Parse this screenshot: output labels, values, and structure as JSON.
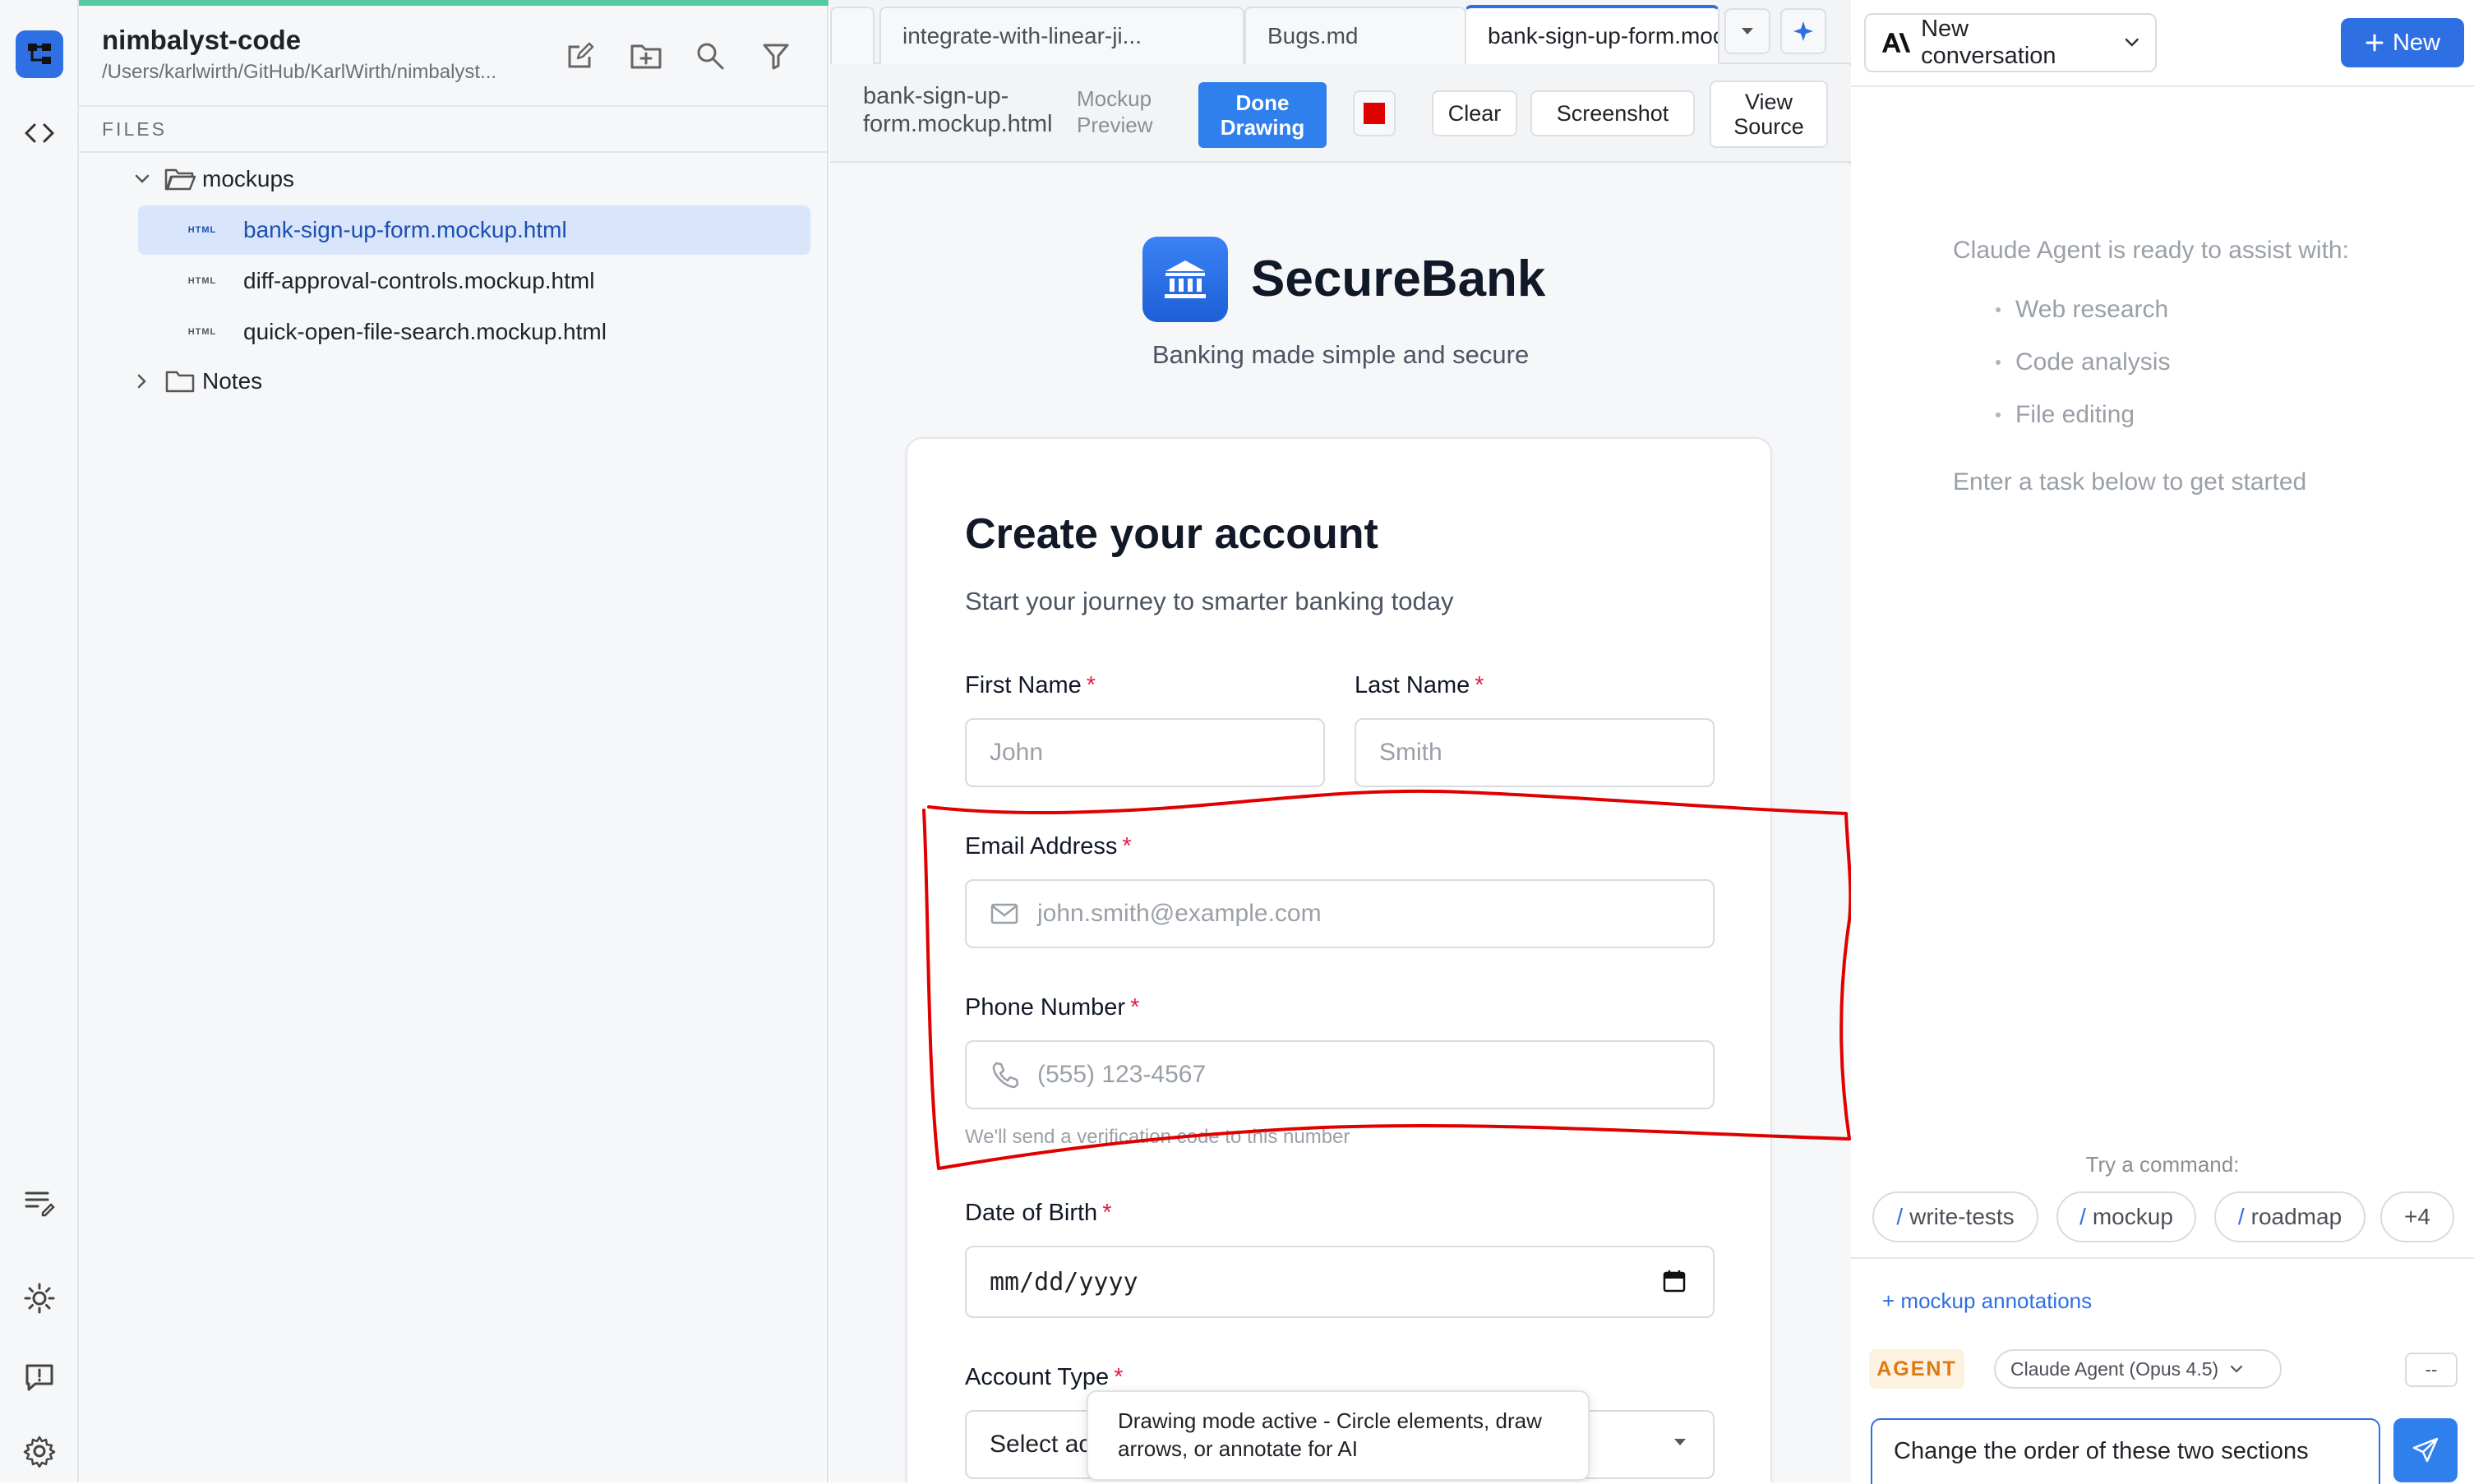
{
  "explorer": {
    "project_name": "nimbalyst-code",
    "project_path": "/Users/karlwirth/GitHub/KarlWirth/nimbalyst...",
    "section_label": "FILES",
    "folders": [
      {
        "name": "mockups",
        "expanded": true
      },
      {
        "name": "Notes",
        "expanded": false
      }
    ],
    "files": [
      {
        "badge": "HTML",
        "name": "bank-sign-up-form.mockup.html",
        "selected": true
      },
      {
        "badge": "HTML",
        "name": "diff-approval-controls.mockup.html",
        "selected": false
      },
      {
        "badge": "HTML",
        "name": "quick-open-file-search.mockup.html",
        "selected": false
      }
    ]
  },
  "tabs": [
    {
      "label": ""
    },
    {
      "label": "integrate-with-linear-ji..."
    },
    {
      "label": "Bugs.md"
    },
    {
      "label": "bank-sign-up-form.mockup.html",
      "active": true
    }
  ],
  "toolbar": {
    "filename": "bank-sign-up-form.mockup.html",
    "mode": "Mockup Preview",
    "done_drawing": "Done Drawing",
    "pen_color": "#e00000",
    "clear": "Clear",
    "screenshot": "Screenshot",
    "view_source": "View Source"
  },
  "mockup": {
    "brand": "SecureBank",
    "tagline": "Banking made simple and secure",
    "title": "Create your account",
    "subtitle": "Start your journey to smarter banking today",
    "required_mark": "*",
    "fields": {
      "first_name": {
        "label": "First Name",
        "placeholder": "John"
      },
      "last_name": {
        "label": "Last Name",
        "placeholder": "Smith"
      },
      "email": {
        "label": "Email Address",
        "placeholder": "john.smith@example.com"
      },
      "phone": {
        "label": "Phone Number",
        "placeholder": "(555) 123-4567",
        "help": "We'll send a verification code to this number"
      },
      "dob": {
        "label": "Date of Birth",
        "value": "mm/dd/yyyy"
      },
      "account_type": {
        "label": "Account Type",
        "value": "Select ac"
      }
    },
    "toast": "Drawing mode active - Circle elements, draw arrows, or annotate for AI"
  },
  "agent": {
    "conversation": "New conversation",
    "new_button": "New",
    "empty_intro": "Claude Agent is ready to assist with:",
    "capabilities": [
      "Web research",
      "Code analysis",
      "File editing"
    ],
    "empty_hint": "Enter a task below to get started",
    "try_label": "Try a command:",
    "commands": [
      {
        "slash": "/",
        "name": "write-tests"
      },
      {
        "slash": "/",
        "name": "mockup"
      },
      {
        "slash": "/",
        "name": "roadmap"
      },
      {
        "slash": "",
        "name": "+4"
      }
    ],
    "annotations_link": "+ mockup annotations",
    "mode_badge": "AGENT",
    "model": "Claude Agent (Opus 4.5)",
    "extra_button": "--",
    "prompt": "Change the order of these two sections"
  },
  "colors": {
    "accent": "#2f6fe4",
    "annotation": "#e00000",
    "explorer_accent": "#55c9a0"
  }
}
